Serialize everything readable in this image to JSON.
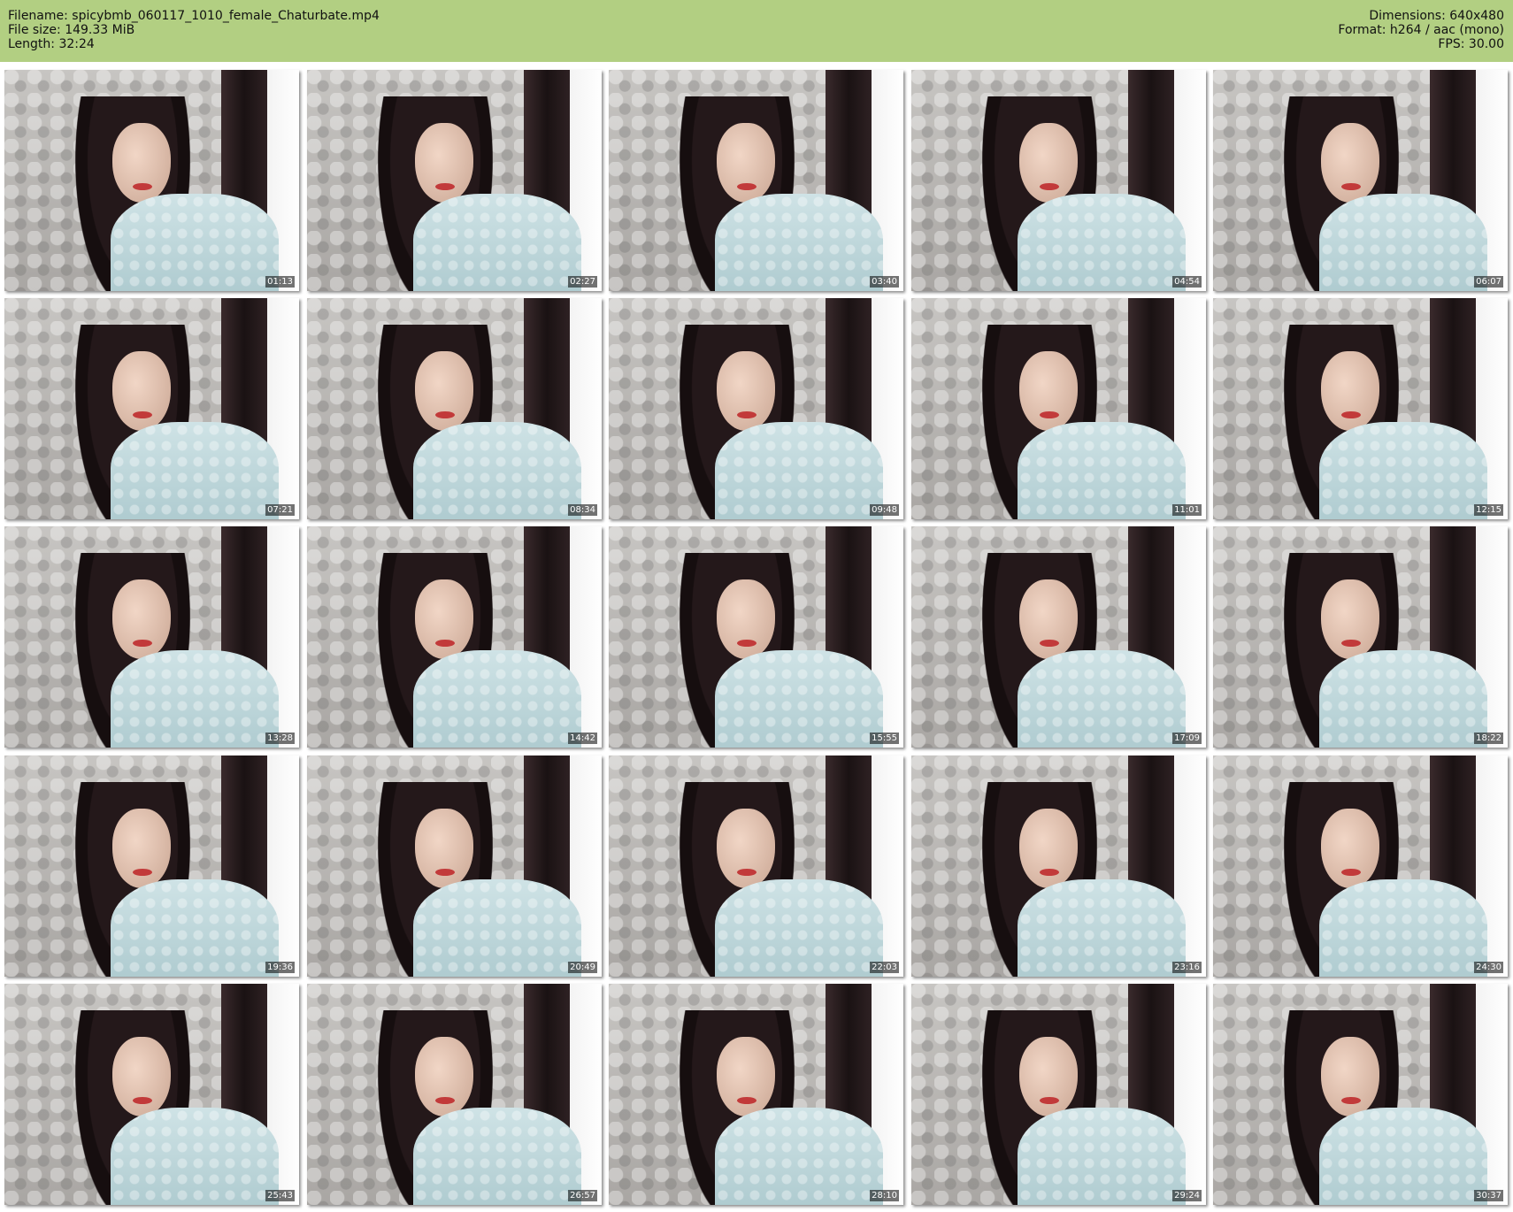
{
  "header": {
    "filename_line": "Filename: spicybmb_060117_1010_female_Chaturbate.mp4",
    "filesize_line": "File size: 149.33 MiB",
    "length_line": "Length: 32:24",
    "dimensions_line": "Dimensions: 640x480",
    "format_line": "Format: h264 / aac (mono)",
    "fps_line": "FPS: 30.00"
  },
  "thumbnails": [
    {
      "time": "01:13"
    },
    {
      "time": "02:27"
    },
    {
      "time": "03:40"
    },
    {
      "time": "04:54"
    },
    {
      "time": "06:07"
    },
    {
      "time": "07:21"
    },
    {
      "time": "08:34"
    },
    {
      "time": "09:48"
    },
    {
      "time": "11:01"
    },
    {
      "time": "12:15"
    },
    {
      "time": "13:28"
    },
    {
      "time": "14:42"
    },
    {
      "time": "15:55"
    },
    {
      "time": "17:09"
    },
    {
      "time": "18:22"
    },
    {
      "time": "19:36"
    },
    {
      "time": "20:49"
    },
    {
      "time": "22:03"
    },
    {
      "time": "23:16"
    },
    {
      "time": "24:30"
    },
    {
      "time": "25:43"
    },
    {
      "time": "26:57"
    },
    {
      "time": "28:10"
    },
    {
      "time": "29:24"
    },
    {
      "time": "30:37"
    }
  ],
  "colors": {
    "header_background": "#b2cf82",
    "timestamp_background": "#000000",
    "timestamp_text": "#ffffff"
  }
}
